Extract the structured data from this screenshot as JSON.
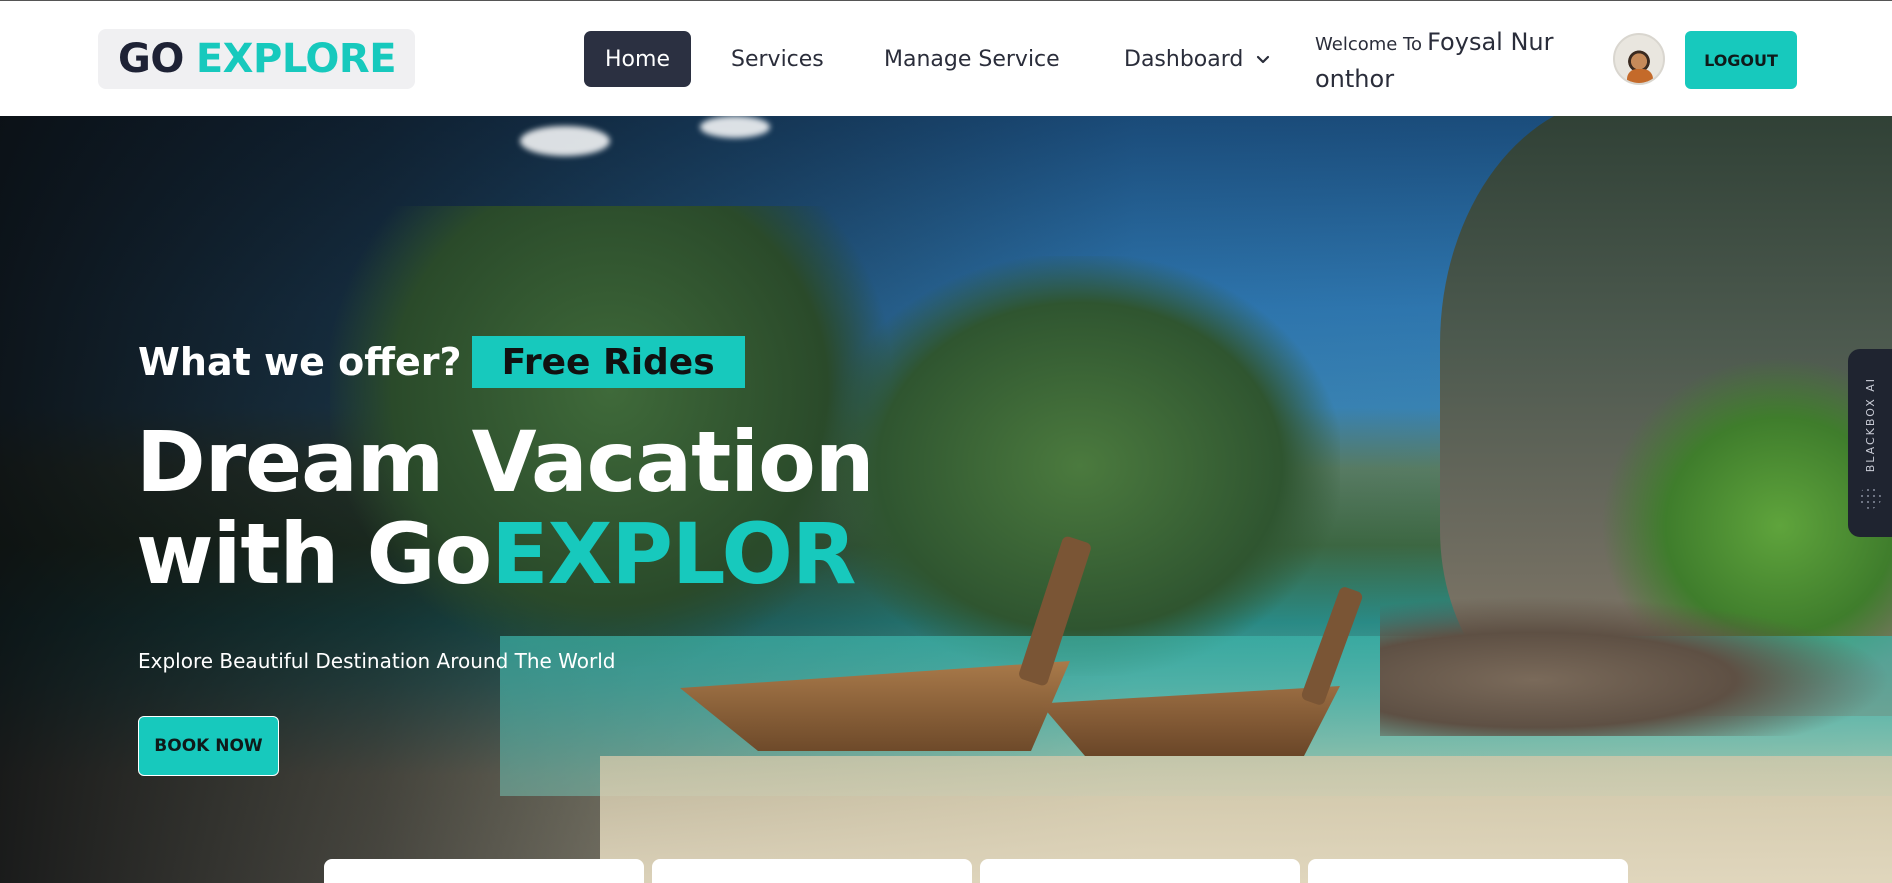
{
  "brand": {
    "part1": "GO",
    "part2": "EXPLORE"
  },
  "nav": {
    "items": [
      {
        "label": "Home",
        "active": true
      },
      {
        "label": "Services"
      },
      {
        "label": "Manage Service"
      },
      {
        "label": "Dashboard",
        "has_dropdown": true
      }
    ]
  },
  "user": {
    "welcome_prefix": "Welcome To",
    "name_line1": "Foysal Nur",
    "name_line2": "onthor",
    "avatar_icon": "user-avatar"
  },
  "logout_label": "LOGOUT",
  "hero": {
    "offer_text": "What we offer?",
    "offer_badge": "Free Rides",
    "headline_line1": "Dream Vacation",
    "headline_line2_prefix": "with Go",
    "headline_line2_accent": "EXPLOR",
    "subtitle": "Explore Beautiful Destination Around The World",
    "cta_label": "BOOK NOW"
  },
  "side_widget": {
    "label": "BLACKBOX AI"
  },
  "colors": {
    "accent": "#17c9bd",
    "dark": "#2b3041",
    "brand_dark": "#1e2235"
  }
}
